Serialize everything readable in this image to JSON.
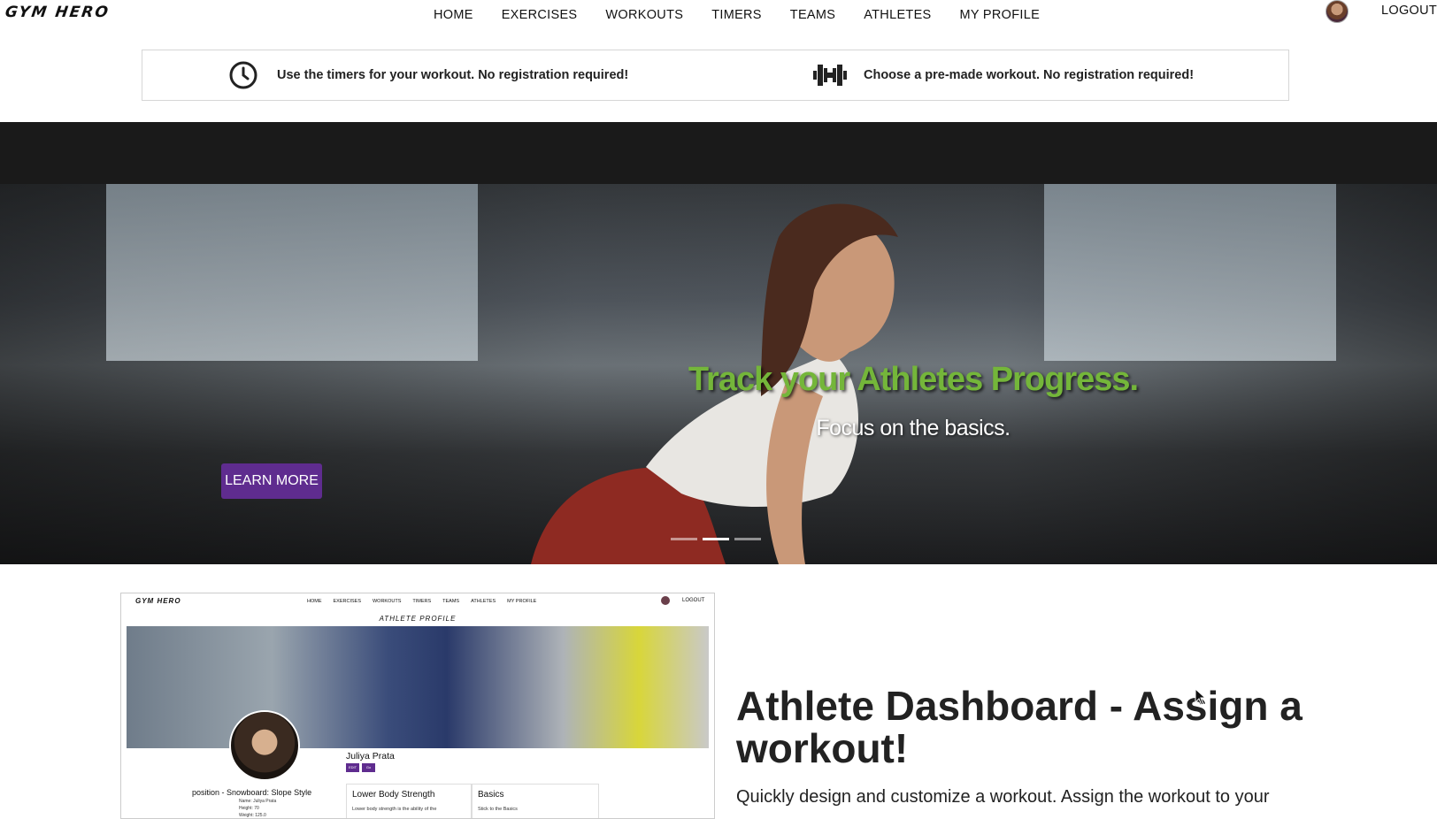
{
  "nav": {
    "logo": "GYM HERO",
    "links": [
      "HOME",
      "EXERCISES",
      "WORKOUTS",
      "TIMERS",
      "TEAMS",
      "ATHLETES",
      "MY PROFILE"
    ],
    "logout": "LOGOUT"
  },
  "info": {
    "timers_text": "Use the timers for your workout. No registration required!",
    "workout_text": "Choose a pre-made workout. No registration required!",
    "timers_icon": "clock-icon",
    "workout_icon": "dumbbell-icon"
  },
  "hero": {
    "title": "Track your Athletes Progress.",
    "subtitle": "Focus on the basics.",
    "button": "LEARN MORE",
    "title_color": "#74b63a",
    "button_color": "#5f2c8f",
    "active_slide": 2,
    "slide_count": 3
  },
  "preview": {
    "logo": "GYM HERO",
    "links": [
      "HOME",
      "EXERCISES",
      "WORKOUTS",
      "TIMERS",
      "TEAMS",
      "ATHLETES",
      "MY PROFILE"
    ],
    "logout": "LOGOUT",
    "heading": "ATHLETE PROFILE",
    "name": "Juliya Prata",
    "tags": [
      "EDIT",
      "Go Back"
    ],
    "position": "position - Snowboard: Slope Style",
    "details": [
      "Name: Juliya Prata",
      "Height: 70",
      "Weight: 125.0"
    ],
    "cards": [
      {
        "title": "Lower Body Strength",
        "text": "Lower body strength is the ability of the"
      },
      {
        "title": "Basics",
        "text": "Stick to the Basics"
      }
    ]
  },
  "dashboard": {
    "title": "Athlete Dashboard - Assign a workout!",
    "text": "Quickly design and customize a workout. Assign the workout to your"
  }
}
